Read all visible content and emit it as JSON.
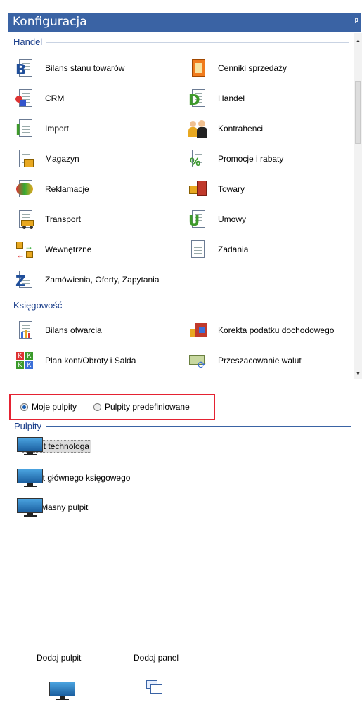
{
  "window": {
    "title": "Konfiguracja",
    "pin": "ᵖ"
  },
  "handel": {
    "title": "Handel",
    "items": [
      "Bilans stanu towarów",
      "Cenniki sprzedaży",
      "CRM",
      "Handel",
      "Import",
      "Kontrahenci",
      "Magazyn",
      "Promocje i rabaty",
      "Reklamacje",
      "Towary",
      "Transport",
      "Umowy",
      "Wewnętrzne",
      "Zadania",
      "Zamówienia, Oferty, Zapytania"
    ]
  },
  "ksiegowosc": {
    "title": "Księgowość",
    "items": [
      "Bilans otwarcia",
      "Korekta podatku dochodowego",
      "Plan kont/Obroty i Salda",
      "Przeszacowanie walut"
    ]
  },
  "radios": {
    "mine": "Moje pulpity",
    "predefined": "Pulpity predefiniowane"
  },
  "pulpity": {
    "title": "Pulpity",
    "items": [
      "Pulpit technologa",
      "Pulpit głównego księgowego",
      "Mój własny pulpit"
    ]
  },
  "footer": {
    "add_desktop": "Dodaj pulpit",
    "add_panel": "Dodaj panel"
  },
  "colors": {
    "titlebar": "#3a63a4",
    "section": "#1a3e8a",
    "highlight_border": "#e52232"
  }
}
